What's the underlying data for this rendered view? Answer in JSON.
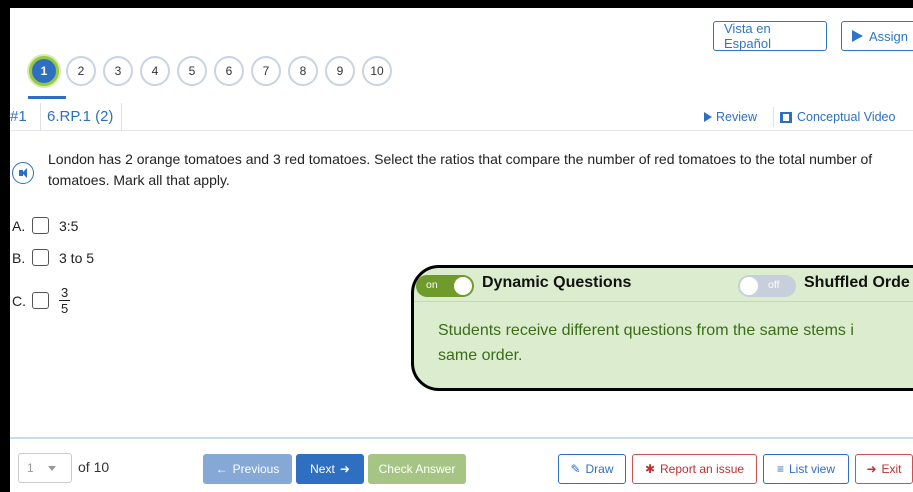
{
  "header": {
    "spanish_label": "Vista en Español",
    "assign_label": "Assign"
  },
  "question_nav": {
    "numbers": [
      "1",
      "2",
      "3",
      "4",
      "5",
      "6",
      "7",
      "8",
      "9",
      "10"
    ],
    "active_index": 0
  },
  "question": {
    "number": "#1",
    "standard": "6.RP.1 (2)",
    "review_label": "Review",
    "video_label": "Conceptual Video",
    "text": "London has 2 orange tomatoes and 3 red tomatoes. Select the ratios that compare the number of red tomatoes to the total number of tomatoes. Mark all that apply.",
    "answers": [
      {
        "letter": "A.",
        "text": "3:5"
      },
      {
        "letter": "B.",
        "text": "3 to 5"
      },
      {
        "letter": "C.",
        "numerator": "3",
        "denominator": "5"
      }
    ]
  },
  "overlay": {
    "on_label": "on",
    "dynamic_title": "Dynamic Questions",
    "off_label": "off",
    "shuffled_title": "Shuffled Orde",
    "description_line1": "Students receive different questions from the same stems i",
    "description_line2": "same order."
  },
  "footer": {
    "page_value": "1",
    "of_total": "of 10",
    "prev_label": "Previous",
    "next_label": "Next",
    "check_label": "Check Answer",
    "draw_label": "Draw",
    "report_label": "Report an issue",
    "list_label": "List view",
    "exit_label": "Exit"
  },
  "colors": {
    "primary": "#2f6fc1",
    "active_ring": "#96c840",
    "overlay_bg": "#dcecce",
    "overlay_text": "#3b6d18",
    "danger": "#c03030"
  }
}
